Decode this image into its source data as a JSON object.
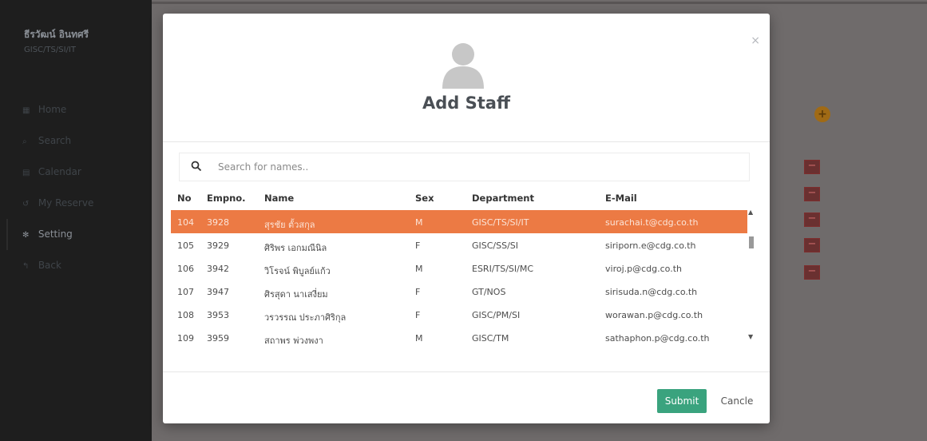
{
  "sidebar": {
    "user_name": "ธีรวัฒน์ อินทศรี",
    "user_dept": "GISC/TS/SI/IT",
    "items": [
      {
        "icon": "home-icon",
        "glyph": "▦",
        "label": "Home"
      },
      {
        "icon": "search-icon",
        "glyph": "⌕",
        "label": "Search"
      },
      {
        "icon": "calendar-icon",
        "glyph": "▤",
        "label": "Calendar"
      },
      {
        "icon": "history-icon",
        "glyph": "↺",
        "label": "My Reserve"
      },
      {
        "icon": "gear-icon",
        "glyph": "✻",
        "label": "Setting"
      },
      {
        "icon": "back-icon",
        "glyph": "↰",
        "label": "Back"
      }
    ],
    "active_index": 4
  },
  "modal": {
    "title": "Add Staff",
    "close_label": "×",
    "search": {
      "placeholder": "Search for names..",
      "value": ""
    },
    "columns": {
      "no": "No",
      "empno": "Empno.",
      "name": "Name",
      "sex": "Sex",
      "department": "Department",
      "email": "E-Mail"
    },
    "rows": [
      {
        "no": "104",
        "empno": "3928",
        "name": "สุรชัย ตั้วสกุล",
        "sex": "M",
        "department": "GISC/TS/SI/IT",
        "email": "surachai.t@cdg.co.th",
        "selected": true
      },
      {
        "no": "105",
        "empno": "3929",
        "name": "ศิริพร เอกมณีนิล",
        "sex": "F",
        "department": "GISC/SS/SI",
        "email": "siriporn.e@cdg.co.th",
        "selected": false
      },
      {
        "no": "106",
        "empno": "3942",
        "name": "วิโรจน์ พิบูลย์แก้ว",
        "sex": "M",
        "department": "ESRI/TS/SI/MC",
        "email": "viroj.p@cdg.co.th",
        "selected": false
      },
      {
        "no": "107",
        "empno": "3947",
        "name": "ศิรสุดา นาเสงี่ยม",
        "sex": "F",
        "department": "GT/NOS",
        "email": "sirisuda.n@cdg.co.th",
        "selected": false
      },
      {
        "no": "108",
        "empno": "3953",
        "name": "วรวรรณ ประภาศิริกุล",
        "sex": "F",
        "department": "GISC/PM/SI",
        "email": "worawan.p@cdg.co.th",
        "selected": false
      },
      {
        "no": "109",
        "empno": "3959",
        "name": "สถาพร พ่วงพงา",
        "sex": "M",
        "department": "GISC/TM",
        "email": "sathaphon.p@cdg.co.th",
        "selected": false
      }
    ],
    "submit_label": "Submit",
    "cancel_label": "Cancle"
  },
  "background": {
    "add_label": "+",
    "remove_label": "−"
  },
  "colors": {
    "selected_row": "#ec7a44",
    "submit": "#3aa37e",
    "accent_orange": "#a06a15",
    "remove_red": "#cc6a6a"
  }
}
